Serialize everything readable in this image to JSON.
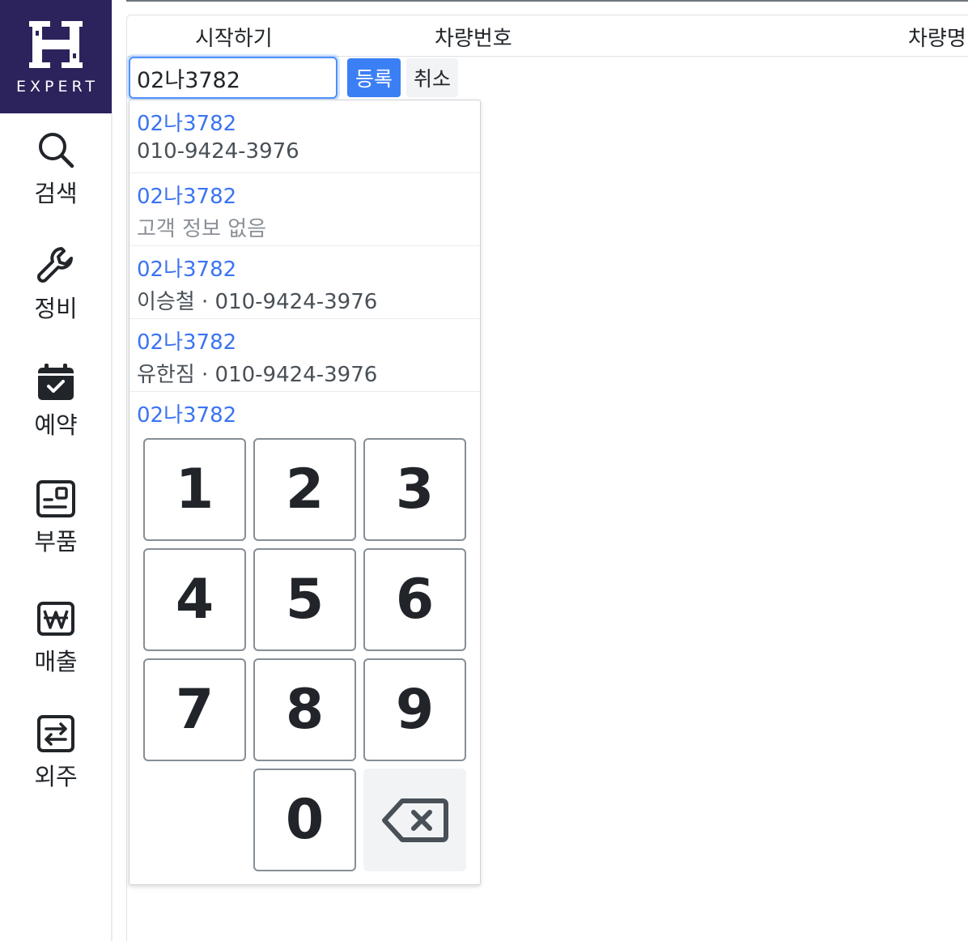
{
  "brand": {
    "logo_text": "EXPERT",
    "color": "#2c235c"
  },
  "sidebar": {
    "items": [
      {
        "label": "검색",
        "icon": "search-icon"
      },
      {
        "label": "정비",
        "icon": "wrench-icon"
      },
      {
        "label": "예약",
        "icon": "calendar-check-icon"
      },
      {
        "label": "부품",
        "icon": "parts-card-icon"
      },
      {
        "label": "매출",
        "icon": "won-sign-icon"
      },
      {
        "label": "외주",
        "icon": "swap-arrows-icon"
      }
    ]
  },
  "table": {
    "columns": [
      "시작하기",
      "차량번호",
      "차량명"
    ]
  },
  "form": {
    "plate_value": "02나3782",
    "register_label": "등록",
    "cancel_label": "취소"
  },
  "suggestions": [
    {
      "plate": "02나3782",
      "detail": "010-9424-3976"
    },
    {
      "plate": "02나3782",
      "detail": "고객 정보 없음"
    },
    {
      "plate": "02나3782",
      "detail": "이승철 · 010-9424-3976"
    },
    {
      "plate": "02나3782",
      "detail": "유한짐 · 010-9424-3976"
    },
    {
      "plate": "02나3782",
      "detail": ""
    }
  ],
  "keypad": {
    "keys": [
      "1",
      "2",
      "3",
      "4",
      "5",
      "6",
      "7",
      "8",
      "9",
      "0"
    ],
    "backspace_icon": "backspace-icon"
  },
  "colors": {
    "accent": "#3b7ff5",
    "link": "#3b74f2"
  }
}
